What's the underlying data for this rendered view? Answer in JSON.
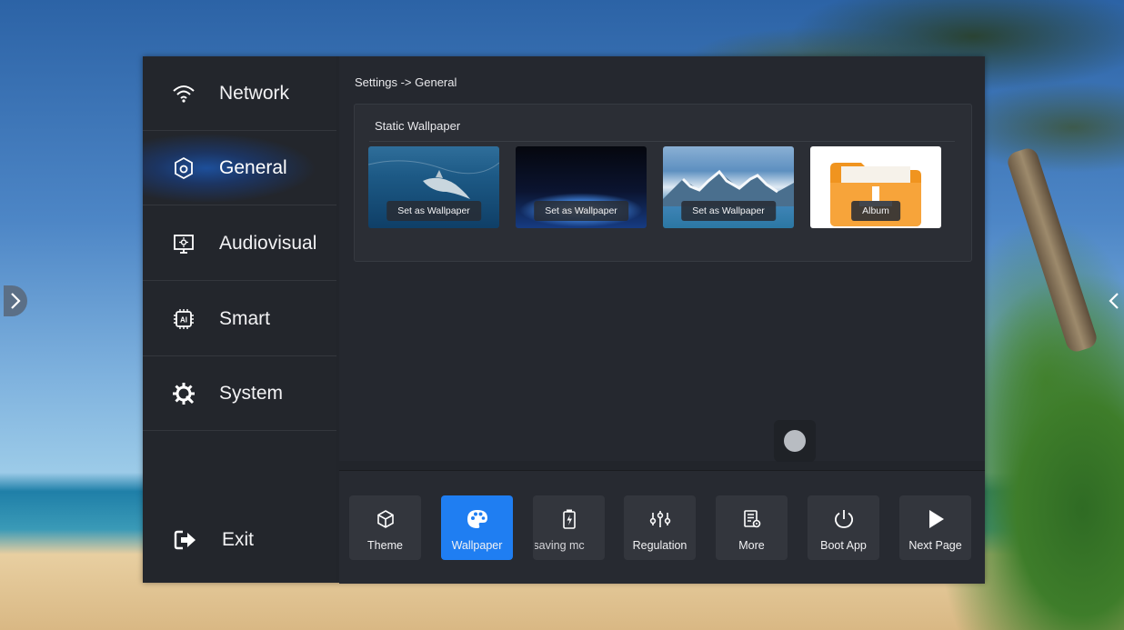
{
  "sidebar": {
    "items": [
      {
        "label": "Network",
        "icon": "wifi-icon"
      },
      {
        "label": "General",
        "icon": "general-settings-icon",
        "active": true
      },
      {
        "label": "Audiovisual",
        "icon": "monitor-icon"
      },
      {
        "label": "Smart",
        "icon": "ai-chip-icon"
      },
      {
        "label": "System",
        "icon": "system-gear-icon"
      }
    ],
    "exit": {
      "label": "Exit",
      "icon": "exit-icon"
    }
  },
  "content": {
    "breadcrumb": "Settings -> General",
    "wallpaper": {
      "title": "Static Wallpaper",
      "thumbs": [
        {
          "button": "Set as Wallpaper"
        },
        {
          "button": "Set as Wallpaper"
        },
        {
          "button": "Set as Wallpaper"
        },
        {
          "button": "Album"
        }
      ]
    }
  },
  "toolbar": {
    "items": [
      {
        "label": "Theme",
        "icon": "cube-icon"
      },
      {
        "label": "Wallpaper",
        "icon": "palette-icon",
        "active": true
      },
      {
        "label": "Energy-saving mode",
        "visible_text": "y-saving mc",
        "icon": "battery-icon"
      },
      {
        "label": "Regulation",
        "icon": "sliders-icon"
      },
      {
        "label": "More",
        "icon": "document-gear-icon"
      },
      {
        "label": "Boot App",
        "icon": "power-icon"
      },
      {
        "label": "Next Page",
        "icon": "play-icon"
      }
    ]
  },
  "colors": {
    "panel": "#22252b",
    "accent": "#1f7ef2",
    "text": "#f2f2f4"
  }
}
